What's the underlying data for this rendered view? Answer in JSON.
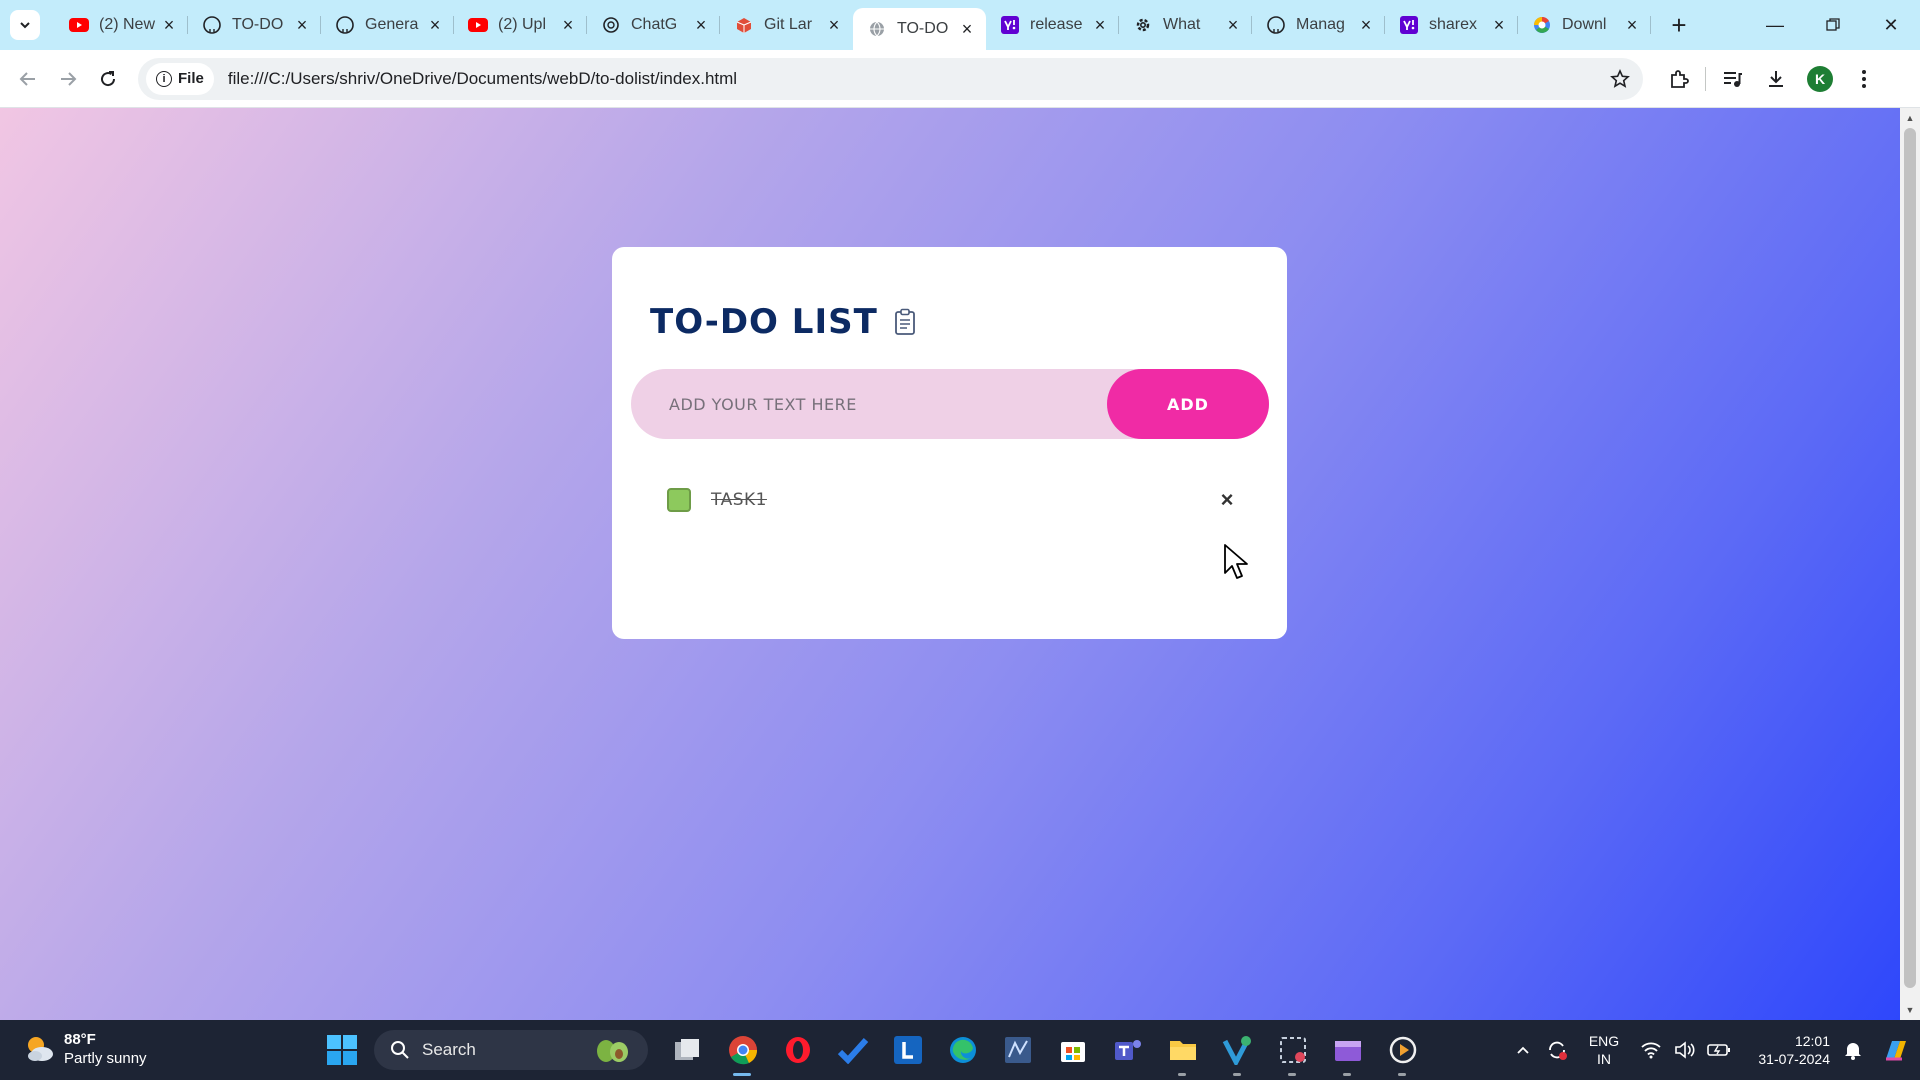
{
  "browser": {
    "tabs": [
      {
        "title": "(2) New",
        "favicon": "youtube-icon"
      },
      {
        "title": "TO-DO",
        "favicon": "github-icon"
      },
      {
        "title": "Genera",
        "favicon": "github-icon"
      },
      {
        "title": "(2) Upl",
        "favicon": "youtube-icon"
      },
      {
        "title": "ChatG",
        "favicon": "chatgpt-icon"
      },
      {
        "title": "Git Lar",
        "favicon": "git-lfs-icon"
      },
      {
        "title": "TO-DO",
        "favicon": "globe-icon",
        "active": true
      },
      {
        "title": "release",
        "favicon": "yahoo-icon"
      },
      {
        "title": "What",
        "favicon": "gear-icon"
      },
      {
        "title": "Manag",
        "favicon": "github-icon"
      },
      {
        "title": "sharex",
        "favicon": "yahoo-icon"
      },
      {
        "title": "Downl",
        "favicon": "google-icon"
      }
    ],
    "address": {
      "chip_label": "File",
      "url": "file:///C:/Users/shriv/OneDrive/Documents/webD/to-dolist/index.html"
    },
    "profile_initial": "K"
  },
  "todo": {
    "title": "TO-DO LIST",
    "input_placeholder": "ADD YOUR TEXT HERE",
    "input_value": "",
    "add_label": "ADD",
    "tasks": [
      {
        "label": "TASK1",
        "checked": true,
        "remove_label": "×"
      }
    ]
  },
  "colors": {
    "gradient_start": "#f1c6e3",
    "gradient_end": "#2e47fb",
    "title": "#0c2a63",
    "input_bg": "#efd0e6",
    "add_button": "#f02ba5",
    "checkbox": "#8dc95d"
  },
  "taskbar": {
    "weather_temp": "88°F",
    "weather_desc": "Partly sunny",
    "search_label": "Search",
    "lang_line1": "ENG",
    "lang_line2": "IN",
    "time": "12:01",
    "date": "31-07-2024"
  }
}
